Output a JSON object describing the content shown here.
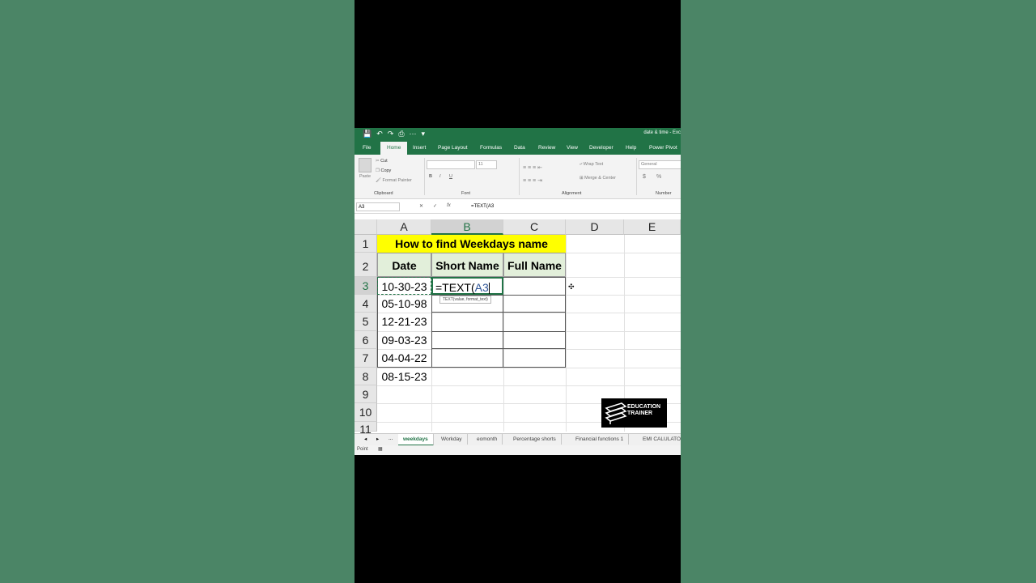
{
  "titlebar": {
    "qat": [
      "💾",
      "↶",
      "↷",
      "⎙",
      "⋯",
      "▾"
    ],
    "doc_title": "date & time - Exc"
  },
  "tabs": [
    "File",
    "Home",
    "Insert",
    "Page Layout",
    "Formulas",
    "Data",
    "Review",
    "View",
    "Developer",
    "Help",
    "Power Pivot"
  ],
  "ribbon": {
    "clipboard": {
      "paste": "Paste",
      "cut": "Cut",
      "copy": "Copy",
      "format_painter": "Format Painter",
      "label": "Clipboard"
    },
    "font": {
      "font_size": "11",
      "bold": "B",
      "italic": "I",
      "underline": "U",
      "label": "Font"
    },
    "alignment": {
      "wrap_text": "Wrap Text",
      "merge": "Merge & Center",
      "label": "Alignment"
    },
    "number": {
      "format": "General",
      "currency": "$",
      "percent": "%",
      "label": "Number"
    }
  },
  "formula_bar": {
    "name_box": "A3",
    "cancel": "✕",
    "enter": "✓",
    "fx": "fx",
    "formula": "=TEXT(A3"
  },
  "columns": [
    "A",
    "B",
    "C",
    "D",
    "E"
  ],
  "rows": [
    "1",
    "2",
    "3",
    "4",
    "5",
    "6",
    "7",
    "8",
    "9",
    "10",
    "11"
  ],
  "sheet": {
    "title": "How to find Weekdays name",
    "headers": [
      "Date",
      "Short Name",
      "Full Name"
    ],
    "dates": [
      "10-30-23",
      "05-10-98",
      "12-21-23",
      "09-03-23",
      "04-04-22",
      "08-15-23"
    ],
    "editing_prefix": "=TEXT(",
    "editing_ref": "A3",
    "tooltip": "TEXT(value, format_text)"
  },
  "sheet_tabs": {
    "nav": [
      "◂",
      "▸",
      "..."
    ],
    "tabs": [
      "weekdays",
      "Workday",
      "eomonth",
      "Percentage shorts",
      "Financial functions 1",
      "EMI CALULATO"
    ]
  },
  "status": {
    "mode": "Point"
  },
  "logo": {
    "line1": "EDUCATION",
    "line2": "TRAINER"
  },
  "colors": {
    "excel_green": "#217346",
    "title_fill": "#ffff00",
    "header_fill": "#e2efda",
    "background": "#4b8566"
  }
}
